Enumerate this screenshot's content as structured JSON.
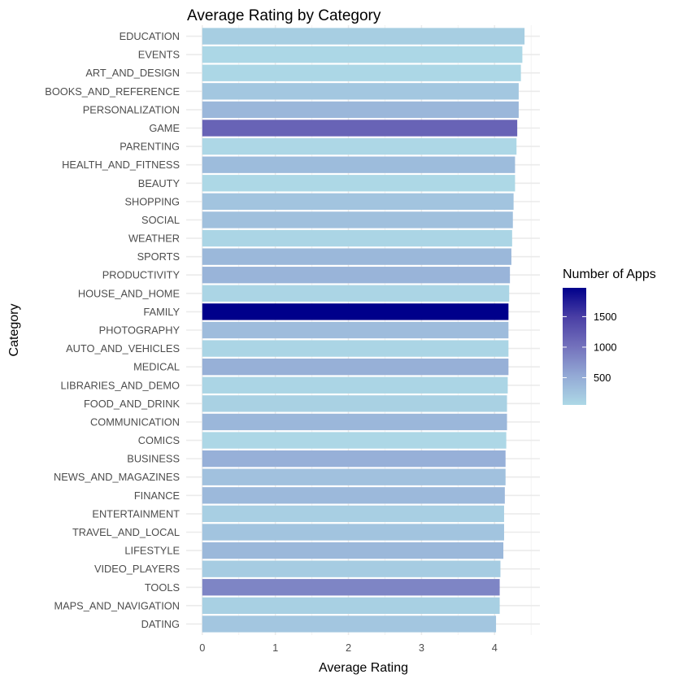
{
  "chart_data": {
    "type": "bar",
    "orientation": "horizontal",
    "title": "Average Rating by Category",
    "xlabel": "Average Rating",
    "ylabel": "Category",
    "xlim": [
      -0.22,
      4.62
    ],
    "xticks": [
      0,
      1,
      2,
      3,
      4
    ],
    "xtick_labels": [
      "0",
      "1",
      "2",
      "3",
      "4"
    ],
    "grid": true,
    "categories": [
      "EDUCATION",
      "EVENTS",
      "ART_AND_DESIGN",
      "BOOKS_AND_REFERENCE",
      "PERSONALIZATION",
      "GAME",
      "PARENTING",
      "HEALTH_AND_FITNESS",
      "BEAUTY",
      "SHOPPING",
      "SOCIAL",
      "WEATHER",
      "SPORTS",
      "PRODUCTIVITY",
      "HOUSE_AND_HOME",
      "FAMILY",
      "PHOTOGRAPHY",
      "AUTO_AND_VEHICLES",
      "MEDICAL",
      "LIBRARIES_AND_DEMO",
      "FOOD_AND_DRINK",
      "COMMUNICATION",
      "COMICS",
      "BUSINESS",
      "NEWS_AND_MAGAZINES",
      "FINANCE",
      "ENTERTAINMENT",
      "TRAVEL_AND_LOCAL",
      "LIFESTYLE",
      "VIDEO_PLAYERS",
      "TOOLS",
      "MAPS_AND_NAVIGATION",
      "DATING"
    ],
    "values": [
      4.41,
      4.38,
      4.36,
      4.33,
      4.33,
      4.31,
      4.3,
      4.28,
      4.28,
      4.26,
      4.25,
      4.24,
      4.23,
      4.21,
      4.2,
      4.19,
      4.19,
      4.19,
      4.19,
      4.18,
      4.17,
      4.17,
      4.16,
      4.15,
      4.15,
      4.14,
      4.13,
      4.13,
      4.12,
      4.08,
      4.07,
      4.07,
      4.02
    ],
    "fill_values": [
      156,
      64,
      65,
      231,
      392,
      1144,
      60,
      341,
      53,
      260,
      295,
      82,
      384,
      424,
      88,
      1972,
      335,
      85,
      463,
      85,
      127,
      387,
      60,
      460,
      283,
      366,
      149,
      258,
      382,
      175,
      843,
      137,
      234
    ],
    "legend": {
      "title": "Number of Apps",
      "type": "colorbar",
      "placement": "right",
      "range": [
        53,
        1972
      ],
      "ticks": [
        500,
        1000,
        1500
      ],
      "tick_labels": [
        "500",
        "1000",
        "1500"
      ],
      "low_color": "#ADD8E6",
      "high_color": "#00008B"
    }
  }
}
